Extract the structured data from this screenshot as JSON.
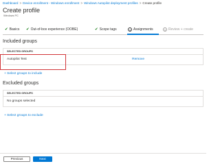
{
  "breadcrumb": [
    "Dashboard",
    "Device enrollment - Windows enrollment",
    "Windows Autopilot deployment profiles",
    "Create profile"
  ],
  "page": {
    "title": "Create profile",
    "subtitle": "Windows PC"
  },
  "tabs": [
    {
      "label": "Basics",
      "state": "complete"
    },
    {
      "label": "Out-of-box experience (OOBE)",
      "state": "complete"
    },
    {
      "label": "Scope tags",
      "state": "complete"
    },
    {
      "label": "Assignments",
      "number": "4",
      "state": "active"
    },
    {
      "label": "Review + create",
      "number": "5",
      "state": "disabled"
    }
  ],
  "included": {
    "title": "Included groups",
    "header": "SELECTED GROUPS",
    "row": {
      "name": "Autopilot Test",
      "action": "Remove"
    },
    "add_link": "+ Select groups to include"
  },
  "excluded": {
    "title": "Excluded groups",
    "header": "SELECTED GROUPS",
    "empty": "No groups selected",
    "add_link": "+ Select groups to exclude"
  },
  "footer": {
    "previous": "Previous",
    "next": "Next"
  },
  "colors": {
    "accent": "#0078d4",
    "check": "#107c10",
    "highlight": "#d13438"
  }
}
